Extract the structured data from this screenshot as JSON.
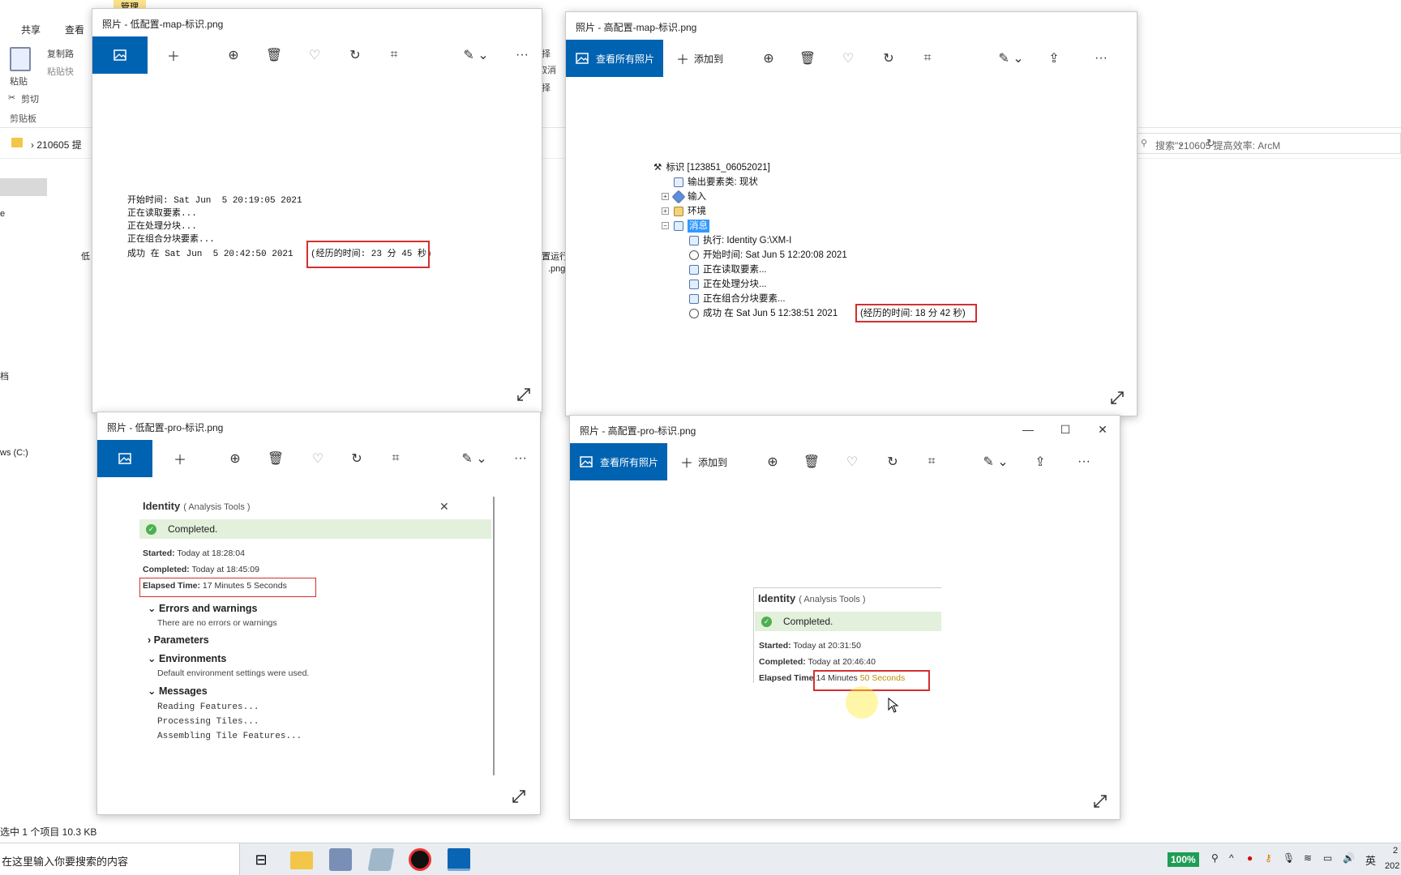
{
  "explorer": {
    "manage_tab": "管理",
    "tabs": [
      "共享",
      "查看"
    ],
    "copy_path": "复制路",
    "paste_shortcut": "粘贴快",
    "paste": "粘贴",
    "cut": "剪切",
    "clipboard": "剪贴板",
    "right_frag_1": "择",
    "right_frag_2": "取消",
    "right_frag_3": "择",
    "address": "210605 提",
    "search_placeholder": "搜索\"210605 提高效率: ArcM",
    "side_docs": "档",
    "side_drive": "ws (C:)",
    "side_e": "e",
    "file_frag_left": "低",
    "file_frag_right": "置运行",
    "file_frag_right2": ".png",
    "status": "选中 1 个项目  10.3 KB"
  },
  "win1": {
    "title": "照片 - 低配置-map-标识.png",
    "log": {
      "line1": "开始时间: Sat Jun  5 20:19:05 2021",
      "line2": "正在读取要素...",
      "line3": "正在处理分块...",
      "line4": "正在组合分块要素...",
      "line5_prefix": "成功 在 Sat Jun  5 20:42:50 2021",
      "line5_elapsed": "(经历的时间: 23 分 45 秒)"
    }
  },
  "win2": {
    "title": "照片 - 高配置-map-标识.png",
    "view_all": "查看所有照片",
    "add_to": "添加到",
    "tree": {
      "root": "标识 [123851_06052021]",
      "output_type": "输出要素类: 现状",
      "input": "输入",
      "env": "环境",
      "messages": "消息",
      "exec": "执行: Identity G:\\XM-I",
      "start": "开始时间: Sat Jun  5 12:20:08 2021",
      "read": "正在读取要素...",
      "process": "正在处理分块...",
      "assemble": "正在组合分块要素...",
      "success_prefix": "成功 在 Sat Jun  5 12:38:51 2021",
      "success_elapsed": "(经历的时间: 18 分 42 秒)"
    }
  },
  "win3": {
    "title": "照片 - 低配置-pro-标识.png",
    "pro": {
      "tool": "Identity",
      "toolbox": "( Analysis Tools )",
      "completed": "Completed.",
      "started_label": "Started:",
      "started_value": "Today at 18:28:04",
      "completed_label": "Completed:",
      "completed_value": "Today at 18:45:09",
      "elapsed_label": "Elapsed Time:",
      "elapsed_value": "17 Minutes 5 Seconds",
      "errors_heading": "Errors and warnings",
      "errors_note": "There are no errors or warnings",
      "parameters_heading": "Parameters",
      "env_heading": "Environments",
      "env_note": "Default environment settings were used.",
      "messages_heading": "Messages",
      "msg1": "Reading Features...",
      "msg2": "Processing Tiles...",
      "msg3": "Assembling Tile Features..."
    }
  },
  "win4": {
    "title": "照片 - 高配置-pro-标识.png",
    "view_all": "查看所有照片",
    "add_to": "添加到",
    "pro": {
      "tool": "Identity",
      "toolbox": "( Analysis Tools )",
      "completed": "Completed.",
      "started_label": "Started:",
      "started_value": "Today at 20:31:50",
      "completed_label": "Completed:",
      "completed_value": "Today at 20:46:40",
      "elapsed_label": "Elapsed Time",
      "elapsed_value_a": "14 Minutes",
      "elapsed_value_b": "50 Seconds"
    }
  },
  "taskbar": {
    "search_text": "在这里输入你要搜索的内容",
    "zoom": "100%",
    "ime": "英",
    "clock_a": "2",
    "clock_b": "202"
  },
  "colors": {
    "accent_blue": "#0063b1",
    "highlight_red": "#d32f2f",
    "completed_green": "#e2f0dc"
  }
}
